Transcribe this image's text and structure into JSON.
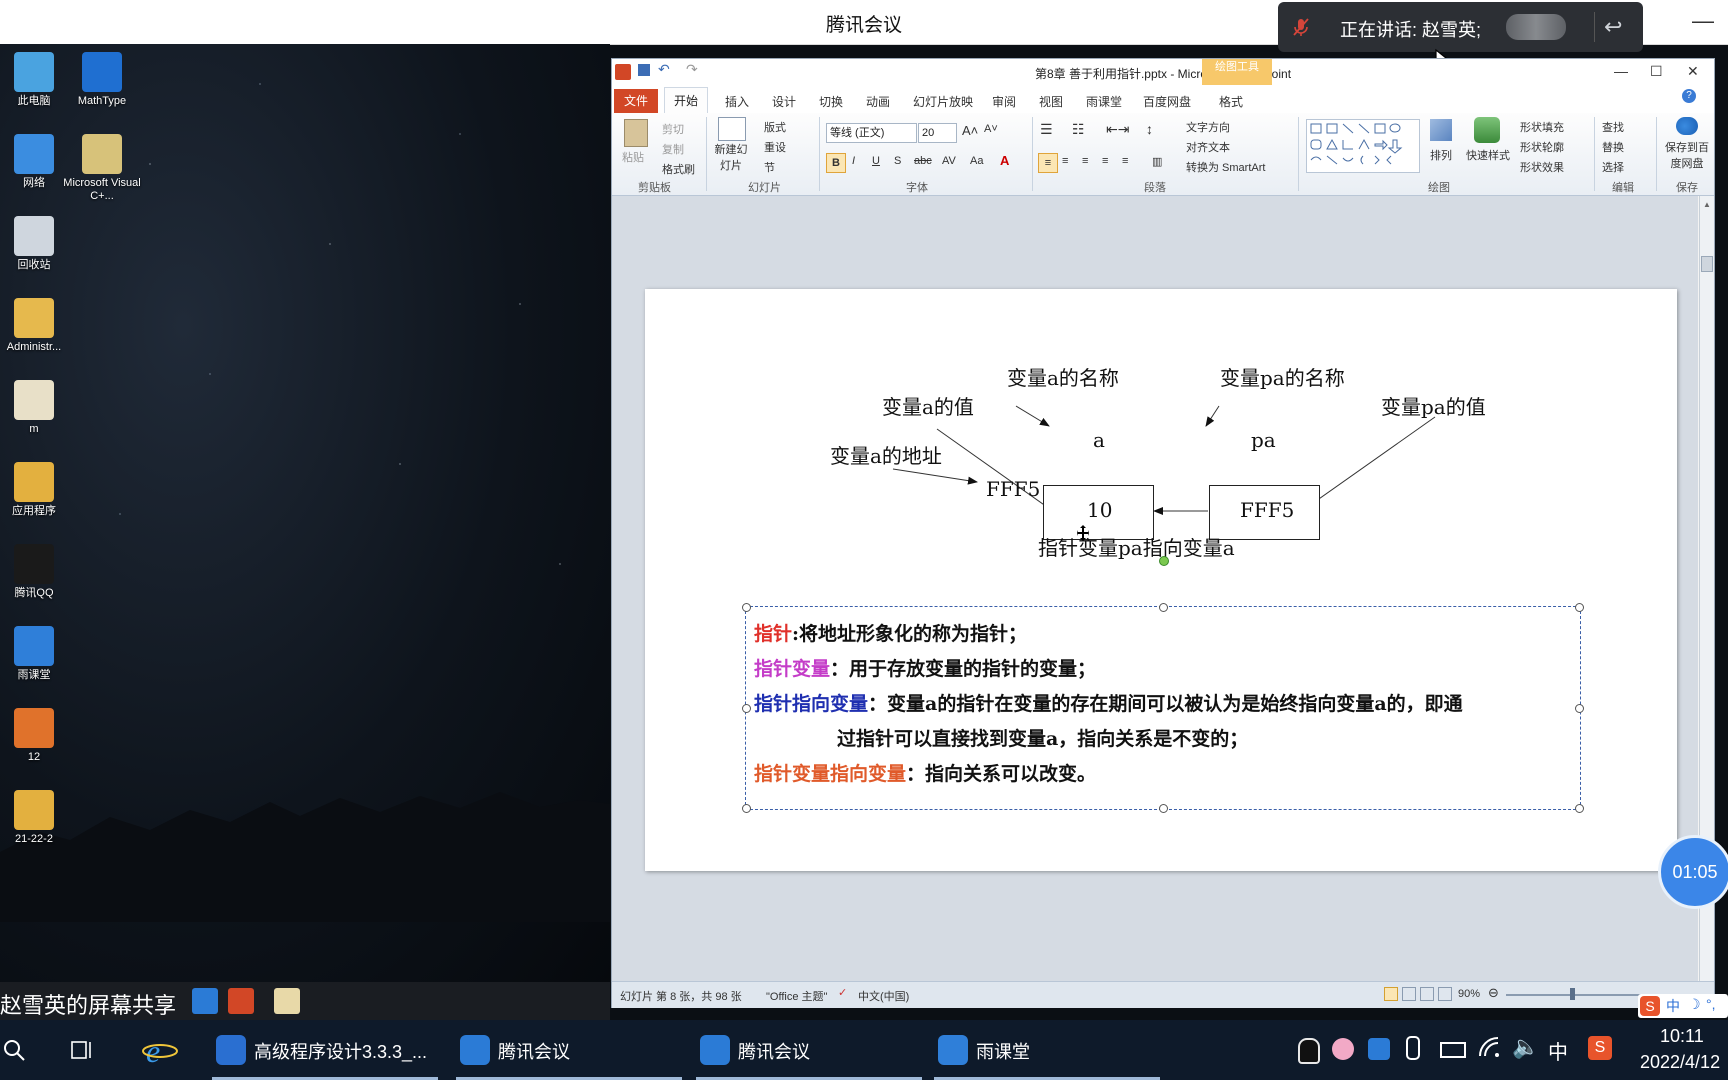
{
  "meeting": {
    "window_title": "腾讯会议",
    "minimize": "—",
    "speaking_label": "正在讲话: 赵雪英;",
    "back_icon": "↩"
  },
  "desktop": {
    "icons": [
      {
        "label": "此电脑",
        "icon": "computer-icon",
        "color": "#4aa3e0"
      },
      {
        "label": "MathType",
        "icon": "sigma-icon",
        "color": "#1f6fd1"
      },
      {
        "label": "网络",
        "icon": "network-globe-icon",
        "color": "#3b8de0"
      },
      {
        "label": "Microsoft Visual C+...",
        "icon": "visual-cpp-icon",
        "color": "#d7c27a"
      },
      {
        "label": "回收站",
        "icon": "recycle-bin-icon",
        "color": "#cfd6de"
      },
      {
        "label": "Administr...",
        "icon": "user-folder-icon",
        "color": "#e6b94d"
      },
      {
        "label": "m",
        "icon": "document-icon",
        "color": "#e8e0c8"
      },
      {
        "label": "应用程序",
        "icon": "folder-icon",
        "color": "#e3b03f"
      },
      {
        "label": "腾讯QQ",
        "icon": "qq-penguin-icon",
        "color": "#1a1a1a"
      },
      {
        "label": "雨课堂",
        "icon": "rain-classroom-icon",
        "color": "#2f7fd9"
      },
      {
        "label": "12",
        "icon": "matlab-icon",
        "color": "#e0722b"
      },
      {
        "label": "21-22-2",
        "icon": "folder-icon",
        "color": "#e3b03f"
      }
    ]
  },
  "share": {
    "text": "赵雪英的屏幕共享"
  },
  "ppt": {
    "title": "第8章 善于利用指针.pptx - Microsoft PowerPoint",
    "drawing_tools": "绘图工具",
    "tabs": [
      "开始",
      "插入",
      "设计",
      "切换",
      "动画",
      "幻灯片放映",
      "审阅",
      "视图",
      "雨课堂",
      "百度网盘",
      "格式"
    ],
    "file_tab": "文件",
    "clipboard": {
      "paste": "粘贴",
      "cut": "剪切",
      "copy": "复制",
      "format_painter": "格式刷",
      "label": "剪贴板"
    },
    "slides": {
      "new_slide": "新建幻灯片",
      "layout": "版式",
      "reset": "重设",
      "section": "节",
      "label": "幻灯片"
    },
    "font": {
      "name": "等线 (正文)",
      "size": "20",
      "label": "字体"
    },
    "paragraph": {
      "text_direction": "文字方向",
      "align_text": "对齐文本",
      "smartart": "转换为 SmartArt",
      "label": "段落"
    },
    "drawing": {
      "arrange": "排列",
      "quick_styles": "快速样式",
      "shape_fill": "形状填充",
      "shape_outline": "形状轮廓",
      "shape_effects": "形状效果",
      "label": "绘图"
    },
    "editing": {
      "find": "查找",
      "replace": "替换",
      "select": "选择",
      "label": "编辑"
    },
    "save": {
      "save_to_baidu": "保存到百度网盘",
      "label": "保存"
    },
    "status": {
      "slide_info": "幻灯片 第 8 张，共 98 张",
      "theme": "\"Office 主题\"",
      "language": "中文(中国)",
      "zoom": "90%"
    }
  },
  "slide": {
    "labels": {
      "a_name": "变量a的名称",
      "pa_name": "变量pa的名称",
      "a_value": "变量a的值",
      "pa_value": "变量pa的值",
      "a_addr": "变量a的地址",
      "a": "a",
      "pa": "pa",
      "fff5_left": "FFF5",
      "box_a": "10",
      "box_pa": "FFF5",
      "caption": "指针变量pa指向变量a"
    },
    "lines": {
      "l1_key": "指针",
      "l1_rest": ":将地址形象化的称为指针；",
      "l2_key": "指针变量",
      "l2_rest": "：用于存放变量的指针的变量；",
      "l3_key": "指针指向变量",
      "l3_rest": "：变量a的指针在变量的存在期间可以被认为是始终指向变量a的，即通",
      "l3_cont": "过指针可以直接找到变量a，指向关系是不变的；",
      "l4_key": "指针变量指向变量",
      "l4_rest": "：指向关系可以改变。"
    },
    "colors": {
      "l1": "#e0302a",
      "l2": "#c43cc8",
      "l3": "#1f2fb0",
      "l4": "#e05a2a"
    }
  },
  "timer": "01:05",
  "taskbar": {
    "items": [
      {
        "label": "高级程序设计3.3.3_...",
        "icon": "sogou-browser-icon"
      },
      {
        "label": "腾讯会议",
        "icon": "tencent-meeting-icon"
      },
      {
        "label": "腾讯会议",
        "icon": "tencent-meeting-icon"
      },
      {
        "label": "雨课堂",
        "icon": "rain-classroom-icon"
      }
    ],
    "ime": "中",
    "time": "10:11",
    "date": "2022/4/12"
  }
}
